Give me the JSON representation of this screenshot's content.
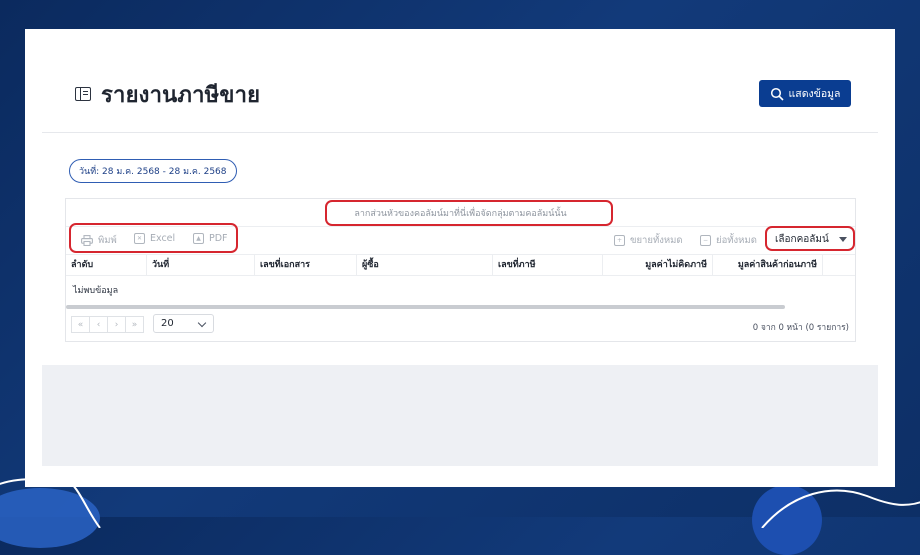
{
  "header": {
    "title": "รายงานภาษีขาย",
    "show_button_label": "แสดงข้อมูล"
  },
  "filter": {
    "date_range": "วันที่: 28 ม.ค. 2568 - 28 ม.ค. 2568"
  },
  "grid": {
    "group_hint": "ลากส่วนหัวของคอลัมน์มาที่นี่เพื่อจัดกลุ่มตามคอลัมน์นั้น",
    "toolbar": {
      "print": "พิมพ์",
      "excel": "Excel",
      "pdf": "PDF",
      "expand_all": "ขยายทั้งหมด",
      "collapse_all": "ย่อทั้งหมด",
      "column_chooser": "เลือกคอลัมน์"
    },
    "columns": [
      "ลำดับ",
      "วันที่",
      "เลขที่เอกสาร",
      "ผู้ซื้อ",
      "เลขที่ภาษี",
      "มูลค่าไม่คิดภาษี",
      "มูลค่าสินค้าก่อนภาษี"
    ],
    "empty_text": "ไม่พบข้อมูล",
    "pager": {
      "page_size": "20",
      "info": "0 จาก 0 หน้า (0 รายการ)",
      "buttons": [
        "«",
        "‹",
        "›",
        "»"
      ]
    }
  },
  "colors": {
    "primary": "#0a3d91",
    "highlight": "#d6262f",
    "background": "#0b2a5e"
  }
}
